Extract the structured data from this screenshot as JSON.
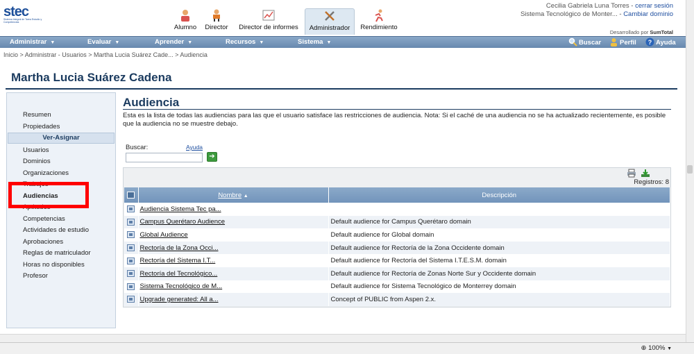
{
  "header": {
    "logo_text": "stec",
    "logo_subtitle": "Sistema Integral de Tarea Estudio y Competencias",
    "roles": [
      {
        "label": "Alumno"
      },
      {
        "label": "Director"
      },
      {
        "label": "Director de informes"
      },
      {
        "label": "Administrador"
      },
      {
        "label": "Rendimiento"
      }
    ],
    "user_name": "Cecilia Gabriela Luna Torres",
    "separator": " - ",
    "logout_link": "cerrar sesión",
    "domain_name": "Sistema Tecnológico de Monter...",
    "change_domain_link": "Cambiar dominio",
    "developed_by": "Desarrollado por",
    "developer": "SumTotal"
  },
  "menu": {
    "items": [
      {
        "label": "Administrar"
      },
      {
        "label": "Evaluar"
      },
      {
        "label": "Aprender"
      },
      {
        "label": "Recursos"
      },
      {
        "label": "Sistema"
      }
    ],
    "tools": [
      {
        "label": "Buscar"
      },
      {
        "label": "Perfil"
      },
      {
        "label": "Ayuda"
      }
    ]
  },
  "breadcrumb": "Inicio > Administrar - Usuarios > Martha Lucia Suárez Cade... > Audiencia",
  "user_title": "Martha Lucia Suárez Cadena",
  "sidenav": {
    "items_top": [
      "Resumen",
      "Propiedades"
    ],
    "group_label": "Ver-Asignar",
    "items": [
      "Usuarios",
      "Dominios",
      "Organizaciones",
      "Trabajos",
      "Audiencias",
      "Aptitudes",
      "Competencias",
      "Actividades de estudio",
      "Aprobaciones",
      "Reglas de matriculador",
      "Horas no disponibles",
      "Profesor"
    ]
  },
  "main": {
    "heading": "Audiencia",
    "description": "Esta es la lista de todas las audiencias para las que el usuario satisface las restricciones de audiencia. Nota: Si el caché de una audiencia no se ha actualizado recientemente, es posible que la audiencia no se muestre debajo.",
    "search_label": "Buscar:",
    "help_link": "Ayuda",
    "search_value": "",
    "records_label": "Registros: 8",
    "columns": {
      "name": "Nombre",
      "sort_indicator": "▲",
      "description": "Descripción"
    },
    "rows": [
      {
        "name": "Audiencia Sistema Tec pa...",
        "description": ""
      },
      {
        "name": "Campus Querétaro Audience",
        "description": "Default audience for Campus Querétaro domain"
      },
      {
        "name": "Global Audience",
        "description": "Default audience for Global domain"
      },
      {
        "name": "Rectoría de la Zona Occi...",
        "description": "Default audience for Rectoría de la Zona Occidente domain"
      },
      {
        "name": "Rectoría del Sistema I.T...",
        "description": "Default audience for Rectoría del Sistema I.T.E.S.M. domain"
      },
      {
        "name": "Rectoría del Tecnológico...",
        "description": "Default audience for Rectoría de Zonas Norte Sur y Occidente domain"
      },
      {
        "name": "Sistema Tecnológico de M...",
        "description": "Default audience for Sistema Tecnológico de Monterrey domain"
      },
      {
        "name": "Upgrade generated: All a...",
        "description": "Concept of PUBLIC from Aspen 2.x."
      }
    ]
  },
  "status": {
    "zoom": "100%"
  }
}
